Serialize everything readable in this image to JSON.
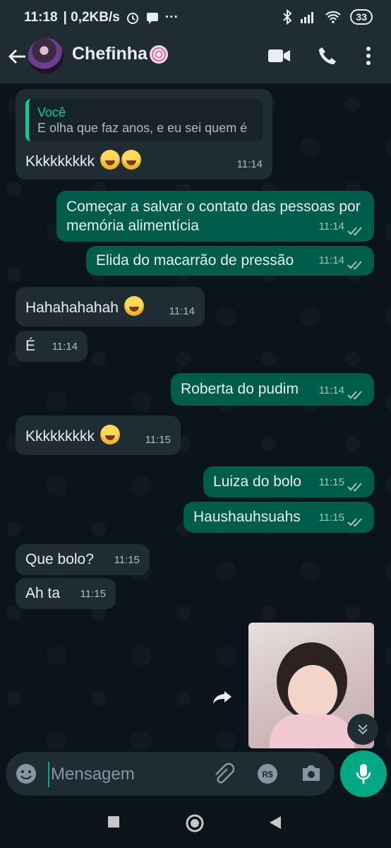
{
  "status_bar": {
    "time": "11:18",
    "speed": "| 0,2KB/s",
    "battery": "33"
  },
  "header": {
    "contact_name": "Chefinha"
  },
  "messages": [
    {
      "dir": "in",
      "quote_author": "Você",
      "quote_text": "E olha que faz anos, e eu sei quem é",
      "text": "Kkkkkkkkk",
      "time": "11:14"
    },
    {
      "dir": "out",
      "text": "Começar a salvar o contato das pessoas por memória alimentícia",
      "time": "11:14"
    },
    {
      "dir": "out",
      "text": "Elida do macarrão de pressão",
      "time": "11:14"
    },
    {
      "dir": "in",
      "text": "Hahahahahah",
      "time": "11:14"
    },
    {
      "dir": "in",
      "text": "É",
      "time": "11:14"
    },
    {
      "dir": "out",
      "text": "Roberta do pudim",
      "time": "11:14"
    },
    {
      "dir": "in",
      "text": "Kkkkkkkkk",
      "time": "11:15"
    },
    {
      "dir": "out",
      "text": "Luiza do bolo",
      "time": "11:15"
    },
    {
      "dir": "out",
      "text": "Haushauhsuahs",
      "time": "11:15"
    },
    {
      "dir": "in",
      "text": "Que bolo?",
      "time": "11:15"
    },
    {
      "dir": "in",
      "text": "Ah ta",
      "time": "11:15"
    }
  ],
  "composer": {
    "placeholder": "Mensagem"
  },
  "colors": {
    "incoming": "#202c33",
    "outgoing": "#005c4b",
    "accent": "#00a884",
    "header": "#1f2c34"
  }
}
